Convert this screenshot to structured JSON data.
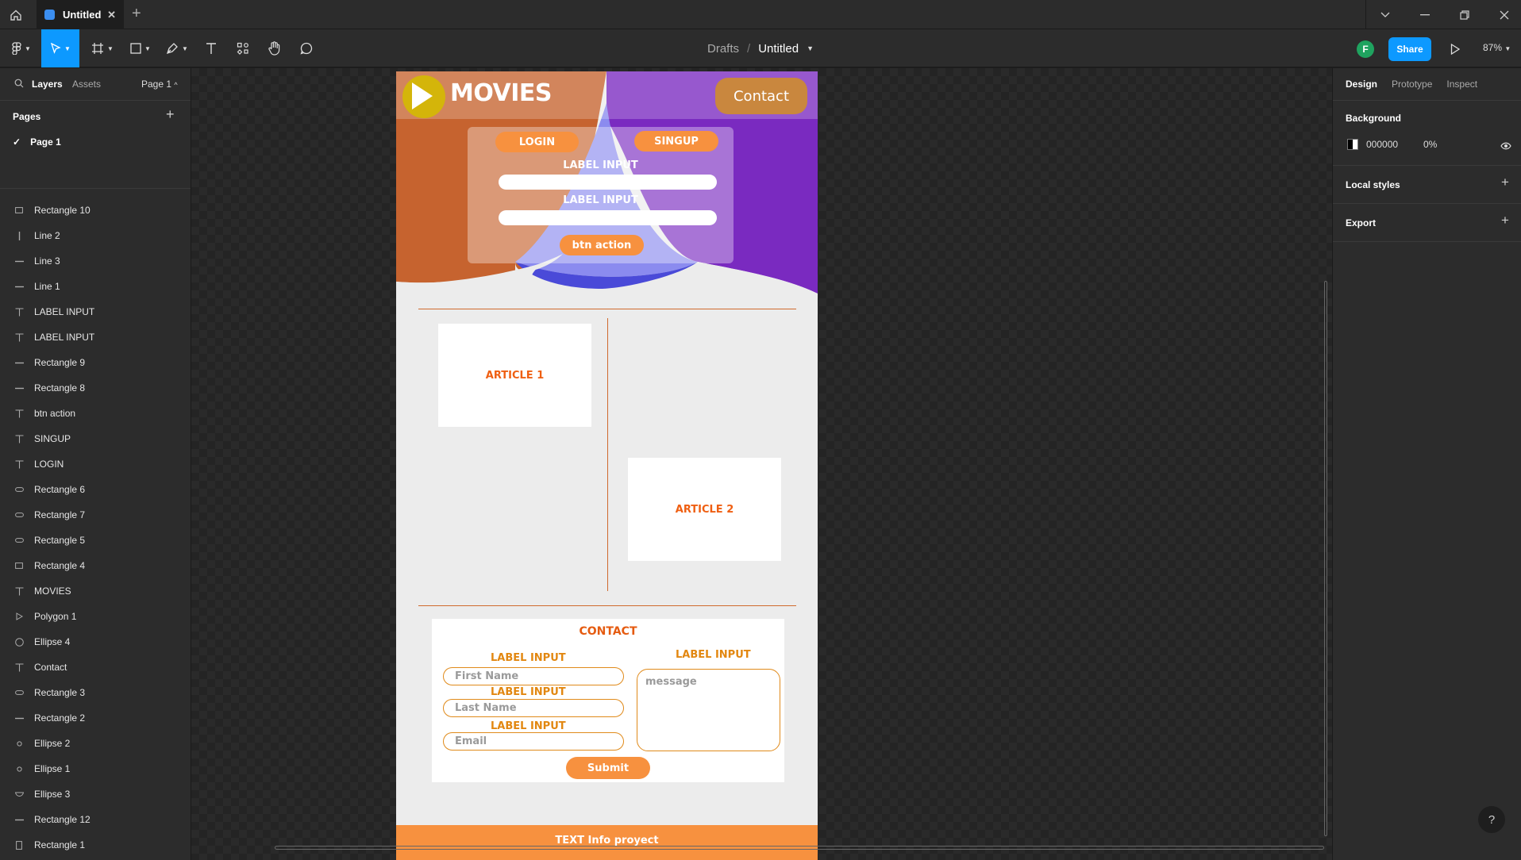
{
  "titlebar": {
    "tab_title": "Untitled"
  },
  "toolbar": {
    "breadcrumb_drafts": "Drafts",
    "breadcrumb_sep": "/",
    "file_name": "Untitled",
    "avatar_letter": "F",
    "share_label": "Share",
    "zoom": "87%"
  },
  "left_panel": {
    "tab_layers": "Layers",
    "tab_assets": "Assets",
    "page_selector": "Page 1",
    "pages_heading": "Pages",
    "current_page": "Page 1",
    "layers": [
      {
        "label": "Rectangle 10",
        "icon": "rect"
      },
      {
        "label": "Line 2",
        "icon": "vline"
      },
      {
        "label": "Line 3",
        "icon": "hline"
      },
      {
        "label": "Line 1",
        "icon": "hline"
      },
      {
        "label": "LABEL INPUT",
        "icon": "text"
      },
      {
        "label": "LABEL INPUT",
        "icon": "text"
      },
      {
        "label": "Rectangle 9",
        "icon": "hline"
      },
      {
        "label": "Rectangle 8",
        "icon": "hline"
      },
      {
        "label": "btn action",
        "icon": "text"
      },
      {
        "label": "SINGUP",
        "icon": "text"
      },
      {
        "label": "LOGIN",
        "icon": "text"
      },
      {
        "label": "Rectangle 6",
        "icon": "pill"
      },
      {
        "label": "Rectangle 7",
        "icon": "pill"
      },
      {
        "label": "Rectangle 5",
        "icon": "pill"
      },
      {
        "label": "Rectangle 4",
        "icon": "rect"
      },
      {
        "label": "MOVIES",
        "icon": "text"
      },
      {
        "label": "Polygon 1",
        "icon": "polygon"
      },
      {
        "label": "Ellipse 4",
        "icon": "ellipse"
      },
      {
        "label": "Contact",
        "icon": "text"
      },
      {
        "label": "Rectangle 3",
        "icon": "pill"
      },
      {
        "label": "Rectangle 2",
        "icon": "hline"
      },
      {
        "label": "Ellipse 2",
        "icon": "dot"
      },
      {
        "label": "Ellipse 1",
        "icon": "dot"
      },
      {
        "label": "Ellipse 3",
        "icon": "bowl"
      },
      {
        "label": "Rectangle 12",
        "icon": "hline"
      },
      {
        "label": "Rectangle 1",
        "icon": "vrect"
      }
    ]
  },
  "mockup": {
    "logo_title": "MOVIES",
    "contact_button": "Contact",
    "login_button": "LOGIN",
    "signup_button": "SINGUP",
    "label_input_1": "LABEL INPUT",
    "label_input_2": "LABEL INPUT",
    "action_button": "btn action",
    "article_1": "ARTICLE 1",
    "article_2": "ARTICLE 2",
    "contact_title": "CONTACT",
    "form_label_1": "LABEL INPUT",
    "form_label_2": "LABEL INPUT",
    "form_label_3": "LABEL INPUT",
    "form_label_message": "LABEL INPUT",
    "first_name_placeholder": "First Name",
    "last_name_placeholder": "Last Name",
    "email_placeholder": "Email",
    "message_placeholder": "message",
    "submit_button": "Submit",
    "footer_text": "TEXT Info proyect",
    "colors": {
      "orange": "#f7913f",
      "rust": "#c6632f",
      "purple": "#7b2cbf",
      "yellow": "#d4b50a"
    }
  },
  "right_panel": {
    "tab_design": "Design",
    "tab_prototype": "Prototype",
    "tab_inspect": "Inspect",
    "background_heading": "Background",
    "background_hex": "000000",
    "background_opacity": "0%",
    "local_styles": "Local styles",
    "export": "Export",
    "help": "?"
  }
}
